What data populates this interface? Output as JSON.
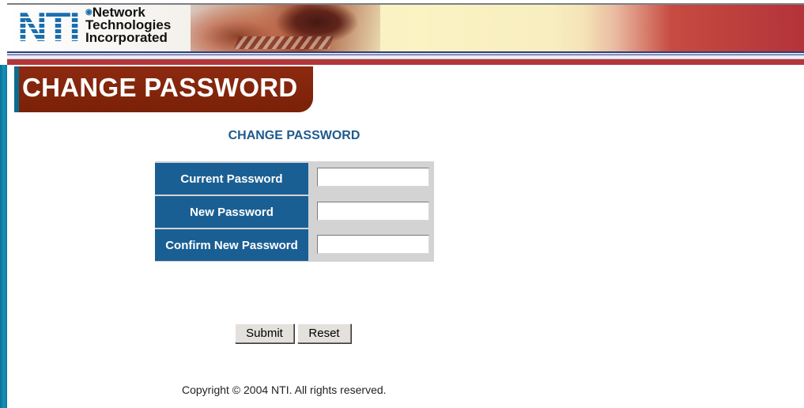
{
  "header": {
    "logo_letters": "NTI",
    "logo_line1": "Network",
    "logo_line2": "Technologies",
    "logo_line3": "Incorporated"
  },
  "page_title": "CHANGE PASSWORD",
  "form": {
    "heading": "CHANGE PASSWORD",
    "fields": [
      {
        "label": "Current Password",
        "value": ""
      },
      {
        "label": "New Password",
        "value": ""
      },
      {
        "label": "Confirm New Password",
        "value": ""
      }
    ],
    "submit_label": "Submit",
    "reset_label": "Reset"
  },
  "footer": {
    "copyright": "Copyright © 2004 NTI. All rights reserved."
  },
  "colors": {
    "title_tab": "#8c2a10",
    "label_bg": "#1a5f94",
    "heading": "#1f5a8c",
    "accent_bar": "#1591b8"
  }
}
